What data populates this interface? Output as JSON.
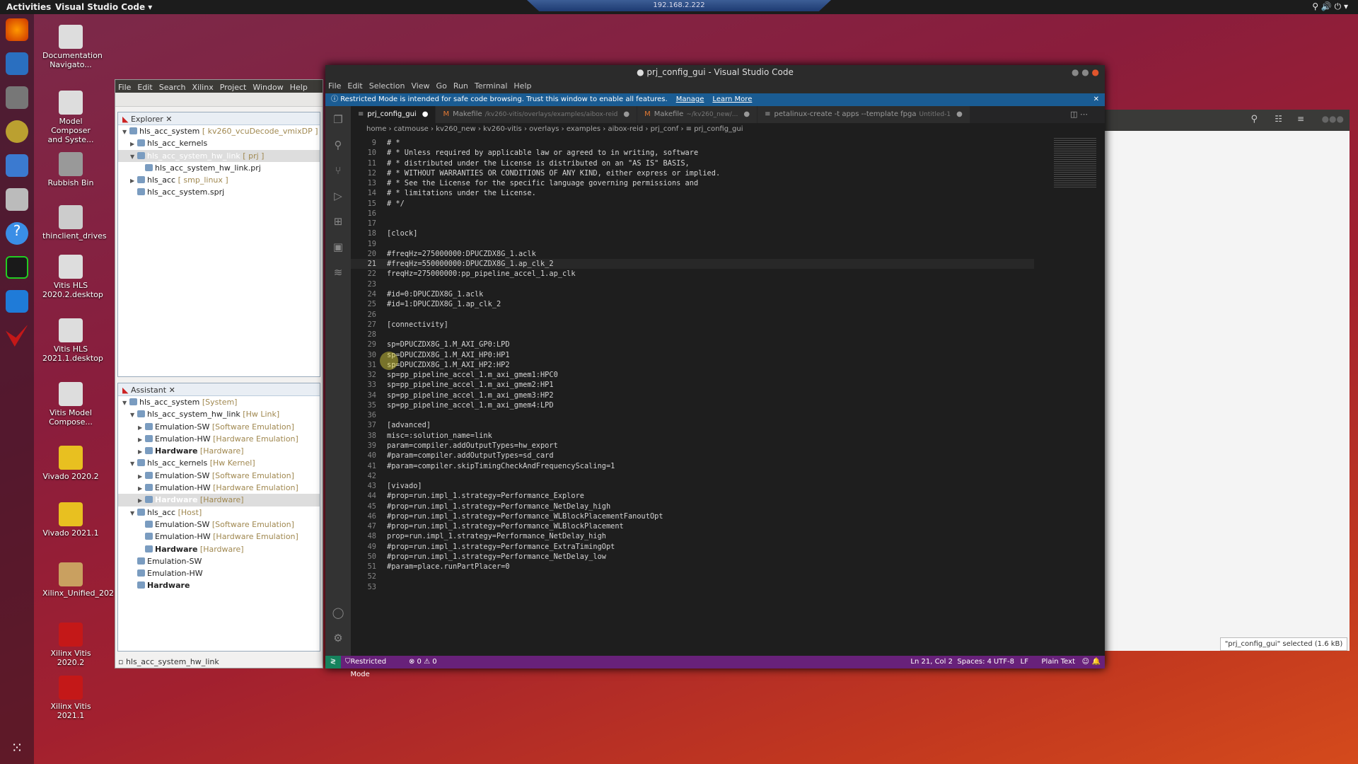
{
  "topbar": {
    "activities": "Activities",
    "app": "Visual Studio Code ▾"
  },
  "remote": {
    "host": "192.168.2.222"
  },
  "desktop": {
    "icons": [
      "Documentation Navigato...",
      "Model Composer and Syste...",
      "Rubbish Bin",
      "thinclient_drives",
      "Vitis HLS 2020.2.desktop",
      "Vitis HLS 2021.1.desktop",
      "Vitis Model Compose...",
      "Vivado 2020.2",
      "Vivado 2021.1",
      "Xilinx_Unified_2021.1_0...",
      "Xilinx Vitis 2020.2",
      "Xilinx Vitis 2021.1"
    ]
  },
  "eclipse": {
    "menu": [
      "File",
      "Edit",
      "Search",
      "Xilinx",
      "Project",
      "Window",
      "Help"
    ],
    "explorer_tab": "Explorer",
    "explorer": [
      {
        "t": "hls_acc_system",
        "d": "[ kv260_vcuDecode_vmixDP ]",
        "lvl": 0,
        "exp": "▼"
      },
      {
        "t": "hls_acc_kernels",
        "d": "",
        "lvl": 1,
        "exp": "▶"
      },
      {
        "t": "hls_acc_system_hw_link",
        "d": "[ prj ]",
        "lvl": 1,
        "exp": "▼",
        "sel": true
      },
      {
        "t": "hls_acc_system_hw_link.prj",
        "d": "",
        "lvl": 2,
        "exp": ""
      },
      {
        "t": "hls_acc",
        "d": "[ smp_linux ]",
        "lvl": 1,
        "exp": "▶"
      },
      {
        "t": "hls_acc_system.sprj",
        "d": "",
        "lvl": 1,
        "exp": ""
      }
    ],
    "assistant_tab": "Assistant",
    "assistant": [
      {
        "t": "hls_acc_system",
        "d": "[System]",
        "lvl": 0,
        "exp": "▼"
      },
      {
        "t": "hls_acc_system_hw_link",
        "d": "[Hw Link]",
        "lvl": 1,
        "exp": "▼"
      },
      {
        "t": "Emulation-SW",
        "d": "[Software Emulation]",
        "lvl": 2,
        "exp": "▶"
      },
      {
        "t": "Emulation-HW",
        "d": "[Hardware Emulation]",
        "lvl": 2,
        "exp": "▶"
      },
      {
        "t": "Hardware",
        "d": "[Hardware]",
        "lvl": 2,
        "exp": "▶",
        "b": true
      },
      {
        "t": "hls_acc_kernels",
        "d": "[Hw Kernel]",
        "lvl": 1,
        "exp": "▼"
      },
      {
        "t": "Emulation-SW",
        "d": "[Software Emulation]",
        "lvl": 2,
        "exp": "▶"
      },
      {
        "t": "Emulation-HW",
        "d": "[Hardware Emulation]",
        "lvl": 2,
        "exp": "▶"
      },
      {
        "t": "Hardware",
        "d": "[Hardware]",
        "lvl": 2,
        "exp": "▶",
        "b": true,
        "sel": true
      },
      {
        "t": "hls_acc",
        "d": "[Host]",
        "lvl": 1,
        "exp": "▼"
      },
      {
        "t": "Emulation-SW",
        "d": "[Software Emulation]",
        "lvl": 2,
        "exp": ""
      },
      {
        "t": "Emulation-HW",
        "d": "[Hardware Emulation]",
        "lvl": 2,
        "exp": ""
      },
      {
        "t": "Hardware",
        "d": "[Hardware]",
        "lvl": 2,
        "exp": "",
        "b": true
      },
      {
        "t": "Emulation-SW",
        "d": "",
        "lvl": 1,
        "exp": ""
      },
      {
        "t": "Emulation-HW",
        "d": "",
        "lvl": 1,
        "exp": ""
      },
      {
        "t": "Hardware",
        "d": "",
        "lvl": 1,
        "exp": "",
        "b": true
      }
    ],
    "status": "hls_acc_system_hw_link"
  },
  "vscode": {
    "title": "● prj_config_gui - Visual Studio Code",
    "menu": [
      "File",
      "Edit",
      "Selection",
      "View",
      "Go",
      "Run",
      "Terminal",
      "Help"
    ],
    "banner": {
      "text": "Restricted Mode is intended for safe code browsing. Trust this window to enable all features.",
      "manage": "Manage",
      "learn": "Learn More"
    },
    "tabs": [
      {
        "icon": "≡",
        "label": "prj_config_gui",
        "path": "",
        "dot": "●",
        "active": true
      },
      {
        "icon": "M",
        "label": "Makefile",
        "path": "/kv260-vitis/overlays/examples/aibox-reid",
        "dot": "●"
      },
      {
        "icon": "M",
        "label": "Makefile",
        "path": "~/kv260_new/...",
        "dot": "●"
      },
      {
        "icon": "≡",
        "label": "petalinux-create -t apps --template fpga",
        "path": "Untitled-1",
        "dot": "●"
      }
    ],
    "breadcrumb": [
      "home",
      "catmouse",
      "kv260_new",
      "kv260-vitis",
      "overlays",
      "examples",
      "aibox-reid",
      "prj_conf",
      "≡ prj_config_gui"
    ],
    "first_line": 9,
    "current_line": 21,
    "lines": [
      "# *",
      "# * Unless required by applicable law or agreed to in writing, software",
      "# * distributed under the License is distributed on an \"AS IS\" BASIS,",
      "# * WITHOUT WARRANTIES OR CONDITIONS OF ANY KIND, either express or implied.",
      "# * See the License for the specific language governing permissions and",
      "# * limitations under the License.",
      "# */",
      "",
      "",
      "[clock]",
      "",
      "#freqHz=275000000:DPUCZDX8G_1.aclk",
      "#freqHz=550000000:DPUCZDX8G_1.ap_clk_2",
      "freqHz=275000000:pp_pipeline_accel_1.ap_clk",
      "",
      "#id=0:DPUCZDX8G_1.aclk",
      "#id=1:DPUCZDX8G_1.ap_clk_2",
      "",
      "[connectivity]",
      "",
      "sp=DPUCZDX8G_1.M_AXI_GP0:LPD",
      "sp=DPUCZDX8G_1.M_AXI_HP0:HP1",
      "sp=DPUCZDX8G_1.M_AXI_HP2:HP2",
      "sp=pp_pipeline_accel_1.m_axi_gmem1:HPC0",
      "sp=pp_pipeline_accel_1.m_axi_gmem2:HP1",
      "sp=pp_pipeline_accel_1.m_axi_gmem3:HP2",
      "sp=pp_pipeline_accel_1.m_axi_gmem4:LPD",
      "",
      "[advanced]",
      "misc=:solution_name=link",
      "param=compiler.addOutputTypes=hw_export",
      "#param=compiler.addOutputTypes=sd_card",
      "#param=compiler.skipTimingCheckAndFrequencyScaling=1",
      "",
      "[vivado]",
      "#prop=run.impl_1.strategy=Performance_Explore",
      "#prop=run.impl_1.strategy=Performance_NetDelay_high",
      "#prop=run.impl_1.strategy=Performance_WLBlockPlacementFanoutOpt",
      "#prop=run.impl_1.strategy=Performance_WLBlockPlacement",
      "prop=run.impl_1.strategy=Performance_NetDelay_high",
      "#prop=run.impl_1.strategy=Performance_ExtraTimingOpt",
      "#prop=run.impl_1.strategy=Performance_NetDelay_low",
      "#param=place.runPartPlacer=0",
      "",
      ""
    ],
    "status": {
      "remote": "≷",
      "mode": "Restricted Mode",
      "problems": "⊗ 0 ⚠ 0",
      "position": "Ln 21, Col 2",
      "spaces": "Spaces: 4",
      "encoding": "UTF-8",
      "eol": "LF",
      "language": "Plain Text"
    },
    "colors": {
      "status": "#68217a",
      "banner": "#1a5c93",
      "editor": "#1e1e1e"
    }
  },
  "nautilus": {
    "tooltip": "\"prj_config_gui\" selected (1.6 kB)"
  }
}
